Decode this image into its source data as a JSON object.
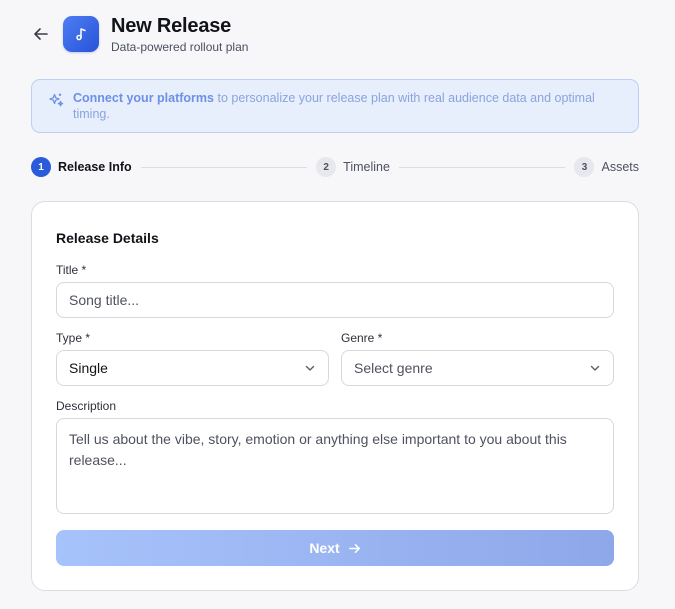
{
  "header": {
    "title": "New Release",
    "subtitle": "Data-powered rollout plan",
    "back_icon": "arrow-left-icon",
    "app_icon": "music-note-icon"
  },
  "banner": {
    "link_text": "Connect your platforms",
    "text": " to personalize your release plan with real audience data and optimal timing.",
    "icon": "sparkle-icon"
  },
  "steps": [
    {
      "number": "1",
      "label": "Release Info",
      "active": true
    },
    {
      "number": "2",
      "label": "Timeline",
      "active": false
    },
    {
      "number": "3",
      "label": "Assets",
      "active": false
    }
  ],
  "form": {
    "section_title": "Release Details",
    "title_label": "Title *",
    "title_placeholder": "Song title...",
    "title_value": "",
    "type_label": "Type *",
    "type_value": "Single",
    "genre_label": "Genre *",
    "genre_placeholder": "Select genre",
    "description_label": "Description",
    "description_placeholder": "Tell us about the vibe, story, emotion or anything else important to you about this release...",
    "description_value": "",
    "next_label": "Next"
  },
  "colors": {
    "accent": "#2a5bdb",
    "banner_bg": "#e7eefc",
    "button_gradient_start": "#a7c3fb",
    "button_gradient_end": "#8ea7e9"
  }
}
